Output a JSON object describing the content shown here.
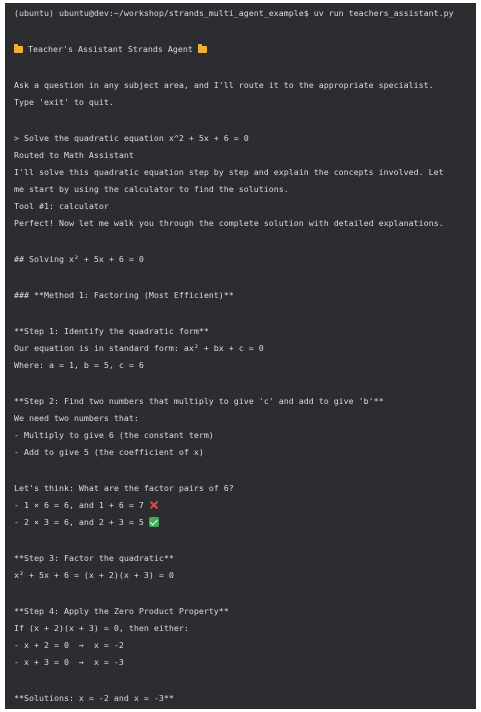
{
  "terminal": {
    "prompt_line": "(ubuntu) ubuntu@dev:~/workshop/strands_multi_agent_example$ uv run teachers_assistant.py",
    "banner_title": " Teacher's Assistant Strands Agent ",
    "banner_icon": "folder-icon",
    "intro_line_1": "Ask a question in any subject area, and I'll route it to the appropriate specialist.",
    "intro_line_2": "Type 'exit' to quit.",
    "user_query": "> Solve the quadratic equation x^2 + 5x + 6 = 0",
    "routed": "Routed to Math Assistant",
    "response_1": "I'll solve this quadratic equation step by step and explain the concepts involved. Let",
    "response_2": "me start by using the calculator to find the solutions.",
    "tool_line": "Tool #1: calculator",
    "perfect_line": "Perfect! Now let me walk you through the complete solution with detailed explanations.",
    "heading_solving": "## Solving x² + 5x + 6 = 0",
    "heading_method": "### **Method 1: Factoring (Most Efficient)**",
    "step1_title": "**Step 1: Identify the quadratic form**",
    "step1_line1": "Our equation is in standard form: ax² + bx + c = 0",
    "step1_line2": "Where: a = 1, b = 5, c = 6",
    "step2_title": "**Step 2: Find two numbers that multiply to give 'c' and add to give 'b'**",
    "step2_line1": "We need two numbers that:",
    "step2_line2": "- Multiply to give 6 (the constant term)",
    "step2_line3": "- Add to give 5 (the coefficient of x)",
    "think_line": "Let's think: What are the factor pairs of 6?",
    "pair1": "- 1 × 6 = 6, and 1 + 6 = 7 ",
    "pair1_icon": "cross-icon",
    "pair2": "- 2 × 3 = 6, and 2 + 3 = 5 ",
    "pair2_icon": "check-icon",
    "step3_title": "**Step 3: Factor the quadratic**",
    "step3_line1": "x² + 5x + 6 = (x + 2)(x + 3) = 0",
    "step4_title": "**Step 4: Apply the Zero Product Property**",
    "step4_line1": "If (x + 2)(x + 3) = 0, then either:",
    "step4_line2": "- x + 2 = 0  →  x = -2",
    "step4_line3": "- x + 3 = 0  →  x = -3",
    "solutions": "**Solutions: x = -2 and x = -3**"
  },
  "colors": {
    "background": "#2b2d30",
    "text": "#dcdcdc",
    "folder": "#f2b133",
    "cross": "#e5484d",
    "check": "#3fae5a"
  }
}
